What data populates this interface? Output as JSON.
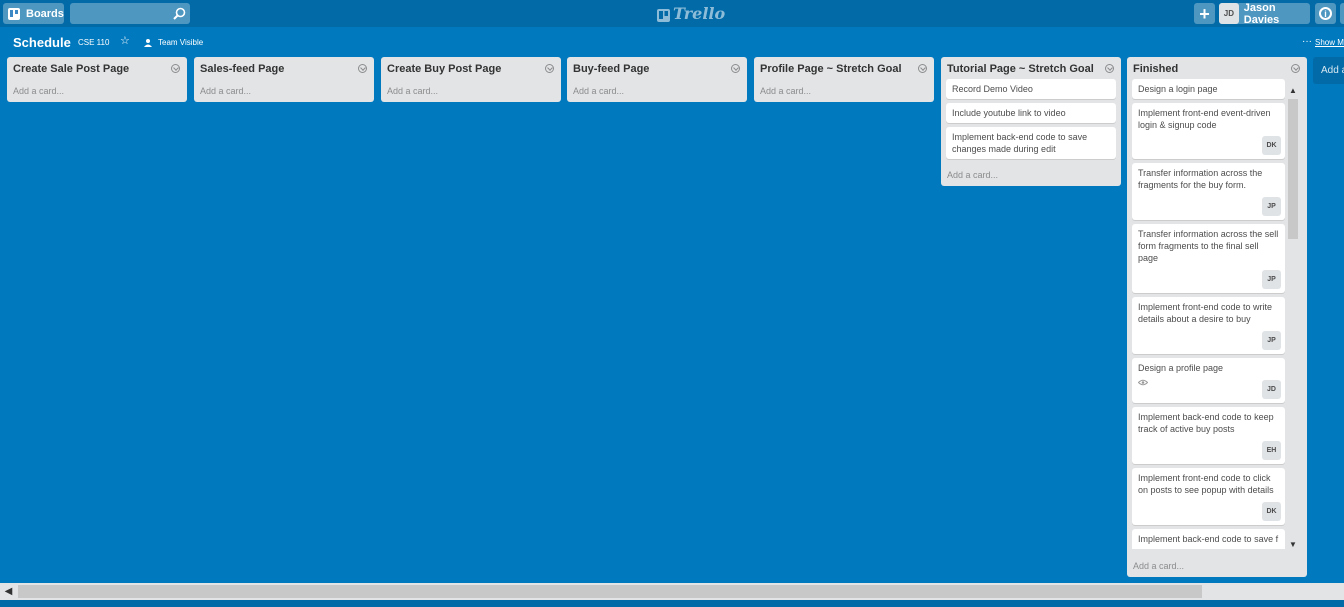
{
  "header": {
    "boards_label": "Boards",
    "search": {
      "value": "",
      "placeholder": ""
    },
    "logo_text": "Trello",
    "add_label": "+",
    "user": {
      "initials": "JD",
      "name": "Jason Davies"
    },
    "info_label": "i"
  },
  "board": {
    "title": "Schedule",
    "org": "CSE 110",
    "visibility": "Team Visible",
    "show_menu": "Show Menu"
  },
  "add_card_label": "Add a card...",
  "lists": [
    {
      "title": "Create Sale Post Page",
      "cards": []
    },
    {
      "title": "Sales-feed Page",
      "cards": []
    },
    {
      "title": "Create Buy Post Page",
      "cards": []
    },
    {
      "title": "Buy-feed Page",
      "cards": []
    },
    {
      "title": "Profile Page ~ Stretch Goal",
      "cards": []
    },
    {
      "title": "Tutorial Page ~ Stretch Goal",
      "cards": [
        {
          "text": "Record Demo Video"
        },
        {
          "text": "Include youtube link to video"
        },
        {
          "text": "Implement back-end code to save changes made during edit"
        }
      ]
    },
    {
      "title": "Finished",
      "cards": [
        {
          "text": "Design a login page"
        },
        {
          "text": "Implement front-end event-driven login & signup code",
          "member": "DK"
        },
        {
          "text": "Transfer information across the fragments for the buy form.",
          "member": "JP"
        },
        {
          "text": "Transfer information across the sell form fragments to the final sell page",
          "member": "JP"
        },
        {
          "text": "Implement front-end code to write details about a desire to buy",
          "member": "JP"
        },
        {
          "text": "Design a profile page",
          "member": "JD",
          "icon": "eye-icon"
        },
        {
          "text": "Implement back-end code to keep track of active buy posts",
          "member": "EH"
        },
        {
          "text": "Implement front-end code to click on posts to see popup with details",
          "member": "DK"
        },
        {
          "text": "Implement back-end code to save f"
        }
      ]
    }
  ],
  "add_list_label": "Add a list...",
  "colors": {
    "board_bg": "#0079bf",
    "header_bg": "#026aa7",
    "list_bg": "#e2e4e6"
  }
}
